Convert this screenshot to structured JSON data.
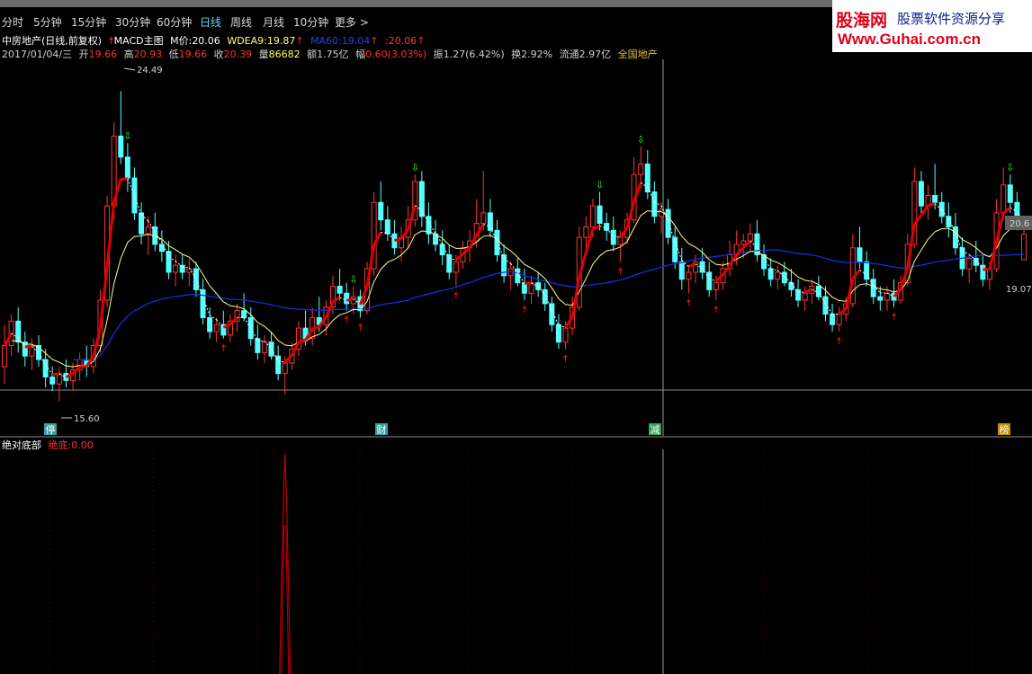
{
  "timeframes": [
    "分时",
    "5分钟",
    "15分钟",
    "30分钟",
    "60分钟",
    "日线",
    "周线",
    "月线",
    "10分钟",
    "更多 >"
  ],
  "active_timeframe": "日线",
  "brand": {
    "name": "股海网",
    "slogan": "股票软件资源分享",
    "url": "Www.Guhai.com.cn"
  },
  "header": {
    "stock": "中房地产(日线,前复权)",
    "indicator": "MACD主图",
    "m_price_label": "M价:",
    "m_price": "20.06",
    "wdea9_label": "WDEA9:",
    "wdea9": "19.87",
    "ma60_label": "MA60:",
    "ma60": "19.04",
    "last_label": ":",
    "last": "20.06"
  },
  "info": {
    "date": "2017/01/04/三",
    "open_label": "开",
    "open": "19.66",
    "high_label": "高",
    "high": "20.93",
    "low_label": "低",
    "low": "19.66",
    "close_label": "收",
    "close": "20.39",
    "vol_label": "量",
    "vol": "86682",
    "amount_label": "额",
    "amount": "1.75亿",
    "change_label": "幅",
    "change": "0.60(3.03%)",
    "amp_label": "振",
    "amp": "1.27(6.42%)",
    "turnover_label": "换",
    "turnover": "2.92%",
    "float_label": "流通",
    "float": "2.97亿",
    "region": "全国地产"
  },
  "sub_panel": {
    "title": "绝对底部",
    "value_label": "绝底:",
    "value": "0.00"
  },
  "price_labels": {
    "high_marker": "24.49",
    "low_marker": "15.60",
    "right_upper": "20.6",
    "right_lower": "19.07"
  },
  "event_markers": [
    "停",
    "财",
    "减",
    "榜"
  ],
  "colors": {
    "up": "#ff3232",
    "down": "#54ffff",
    "ma_fast": "#e00000",
    "ma_slow": "#ffff80",
    "ma60": "#1030e0",
    "buy_arrow": "#ff0000",
    "sell_arrow": "#30ff30"
  },
  "chart_data": {
    "type": "candlestick",
    "ylim": [
      15.0,
      25.4
    ],
    "candles": [
      {
        "o": 16.6,
        "h": 17.8,
        "l": 16.1,
        "c": 17.2
      },
      {
        "o": 17.2,
        "h": 18.1,
        "l": 16.9,
        "c": 17.9
      },
      {
        "o": 17.9,
        "h": 18.3,
        "l": 17.0,
        "c": 17.3
      },
      {
        "o": 17.3,
        "h": 17.6,
        "l": 16.6,
        "c": 16.9
      },
      {
        "o": 16.9,
        "h": 17.4,
        "l": 16.5,
        "c": 17.2
      },
      {
        "o": 17.2,
        "h": 17.5,
        "l": 16.6,
        "c": 16.8
      },
      {
        "o": 16.8,
        "h": 17.1,
        "l": 16.0,
        "c": 16.3
      },
      {
        "o": 16.3,
        "h": 16.6,
        "l": 15.9,
        "c": 16.1
      },
      {
        "o": 16.1,
        "h": 16.6,
        "l": 15.6,
        "c": 16.4
      },
      {
        "o": 16.4,
        "h": 16.8,
        "l": 16.0,
        "c": 16.2
      },
      {
        "o": 16.2,
        "h": 16.7,
        "l": 15.9,
        "c": 16.5
      },
      {
        "o": 16.5,
        "h": 17.0,
        "l": 16.2,
        "c": 16.8
      },
      {
        "o": 16.8,
        "h": 17.2,
        "l": 16.3,
        "c": 16.6
      },
      {
        "o": 16.6,
        "h": 17.4,
        "l": 16.4,
        "c": 17.2
      },
      {
        "o": 17.2,
        "h": 18.8,
        "l": 17.0,
        "c": 18.5
      },
      {
        "o": 18.5,
        "h": 21.5,
        "l": 18.3,
        "c": 21.2
      },
      {
        "o": 21.2,
        "h": 23.6,
        "l": 20.8,
        "c": 23.2
      },
      {
        "o": 23.2,
        "h": 24.49,
        "l": 22.4,
        "c": 22.6
      },
      {
        "o": 22.6,
        "h": 23.0,
        "l": 21.6,
        "c": 22.0
      },
      {
        "o": 22.0,
        "h": 22.3,
        "l": 20.8,
        "c": 21.0
      },
      {
        "o": 21.0,
        "h": 21.3,
        "l": 20.1,
        "c": 20.4
      },
      {
        "o": 20.4,
        "h": 20.9,
        "l": 19.8,
        "c": 20.6
      },
      {
        "o": 20.6,
        "h": 21.0,
        "l": 19.9,
        "c": 20.1
      },
      {
        "o": 20.1,
        "h": 20.5,
        "l": 19.6,
        "c": 19.9
      },
      {
        "o": 19.9,
        "h": 20.2,
        "l": 19.1,
        "c": 19.3
      },
      {
        "o": 19.3,
        "h": 19.8,
        "l": 18.9,
        "c": 19.5
      },
      {
        "o": 19.5,
        "h": 19.8,
        "l": 19.1,
        "c": 19.3
      },
      {
        "o": 19.3,
        "h": 19.7,
        "l": 18.9,
        "c": 19.4
      },
      {
        "o": 19.4,
        "h": 19.6,
        "l": 18.6,
        "c": 18.8
      },
      {
        "o": 18.8,
        "h": 19.1,
        "l": 17.8,
        "c": 18.0
      },
      {
        "o": 18.0,
        "h": 18.3,
        "l": 17.4,
        "c": 17.6
      },
      {
        "o": 17.6,
        "h": 18.0,
        "l": 17.3,
        "c": 17.8
      },
      {
        "o": 17.8,
        "h": 18.2,
        "l": 17.4,
        "c": 17.5
      },
      {
        "o": 17.5,
        "h": 18.1,
        "l": 17.3,
        "c": 17.9
      },
      {
        "o": 17.9,
        "h": 18.4,
        "l": 17.6,
        "c": 18.2
      },
      {
        "o": 18.2,
        "h": 18.7,
        "l": 17.9,
        "c": 18.0
      },
      {
        "o": 18.0,
        "h": 18.3,
        "l": 17.2,
        "c": 17.4
      },
      {
        "o": 17.4,
        "h": 17.8,
        "l": 16.8,
        "c": 17.0
      },
      {
        "o": 17.0,
        "h": 17.5,
        "l": 16.7,
        "c": 17.3
      },
      {
        "o": 17.3,
        "h": 17.6,
        "l": 16.8,
        "c": 16.9
      },
      {
        "o": 16.9,
        "h": 17.2,
        "l": 16.2,
        "c": 16.4
      },
      {
        "o": 16.4,
        "h": 16.9,
        "l": 15.8,
        "c": 16.7
      },
      {
        "o": 16.7,
        "h": 17.3,
        "l": 16.5,
        "c": 17.1
      },
      {
        "o": 17.1,
        "h": 17.9,
        "l": 16.9,
        "c": 17.7
      },
      {
        "o": 17.7,
        "h": 18.2,
        "l": 17.2,
        "c": 17.4
      },
      {
        "o": 17.4,
        "h": 18.3,
        "l": 17.2,
        "c": 18.0
      },
      {
        "o": 18.0,
        "h": 18.6,
        "l": 17.6,
        "c": 17.8
      },
      {
        "o": 17.8,
        "h": 18.5,
        "l": 17.5,
        "c": 18.3
      },
      {
        "o": 18.3,
        "h": 19.2,
        "l": 18.1,
        "c": 18.9
      },
      {
        "o": 18.9,
        "h": 19.4,
        "l": 18.5,
        "c": 18.7
      },
      {
        "o": 18.7,
        "h": 19.0,
        "l": 18.2,
        "c": 18.4
      },
      {
        "o": 18.4,
        "h": 18.9,
        "l": 18.1,
        "c": 18.6
      },
      {
        "o": 18.6,
        "h": 18.8,
        "l": 18.0,
        "c": 18.2
      },
      {
        "o": 18.2,
        "h": 19.6,
        "l": 18.1,
        "c": 19.4
      },
      {
        "o": 19.4,
        "h": 21.6,
        "l": 19.2,
        "c": 21.3
      },
      {
        "o": 21.3,
        "h": 21.9,
        "l": 20.5,
        "c": 20.8
      },
      {
        "o": 20.8,
        "h": 21.2,
        "l": 20.2,
        "c": 20.4
      },
      {
        "o": 20.4,
        "h": 20.8,
        "l": 19.8,
        "c": 20.0
      },
      {
        "o": 20.0,
        "h": 20.6,
        "l": 19.6,
        "c": 20.3
      },
      {
        "o": 20.3,
        "h": 21.2,
        "l": 20.0,
        "c": 20.8
      },
      {
        "o": 20.8,
        "h": 22.1,
        "l": 20.6,
        "c": 21.9
      },
      {
        "o": 21.9,
        "h": 22.2,
        "l": 20.6,
        "c": 20.9
      },
      {
        "o": 20.9,
        "h": 21.3,
        "l": 20.1,
        "c": 20.4
      },
      {
        "o": 20.4,
        "h": 20.8,
        "l": 19.9,
        "c": 20.1
      },
      {
        "o": 20.1,
        "h": 20.5,
        "l": 19.5,
        "c": 19.8
      },
      {
        "o": 19.8,
        "h": 20.1,
        "l": 19.1,
        "c": 19.3
      },
      {
        "o": 19.3,
        "h": 19.8,
        "l": 18.9,
        "c": 19.6
      },
      {
        "o": 19.6,
        "h": 20.2,
        "l": 19.4,
        "c": 20.0
      },
      {
        "o": 20.0,
        "h": 20.5,
        "l": 19.6,
        "c": 20.2
      },
      {
        "o": 20.2,
        "h": 21.4,
        "l": 20.0,
        "c": 20.7
      },
      {
        "o": 20.7,
        "h": 22.2,
        "l": 20.5,
        "c": 21.0
      },
      {
        "o": 21.0,
        "h": 21.4,
        "l": 20.3,
        "c": 20.5
      },
      {
        "o": 20.5,
        "h": 20.8,
        "l": 19.6,
        "c": 19.8
      },
      {
        "o": 19.8,
        "h": 20.1,
        "l": 19.0,
        "c": 19.2
      },
      {
        "o": 19.2,
        "h": 19.6,
        "l": 18.8,
        "c": 19.4
      },
      {
        "o": 19.4,
        "h": 19.7,
        "l": 18.9,
        "c": 19.0
      },
      {
        "o": 19.0,
        "h": 19.4,
        "l": 18.5,
        "c": 18.7
      },
      {
        "o": 18.7,
        "h": 19.2,
        "l": 18.4,
        "c": 19.0
      },
      {
        "o": 19.0,
        "h": 19.3,
        "l": 18.6,
        "c": 18.8
      },
      {
        "o": 18.8,
        "h": 19.0,
        "l": 18.2,
        "c": 18.4
      },
      {
        "o": 18.4,
        "h": 18.6,
        "l": 17.6,
        "c": 17.8
      },
      {
        "o": 17.8,
        "h": 18.1,
        "l": 17.1,
        "c": 17.3
      },
      {
        "o": 17.3,
        "h": 17.9,
        "l": 17.1,
        "c": 17.7
      },
      {
        "o": 17.7,
        "h": 18.6,
        "l": 17.5,
        "c": 18.3
      },
      {
        "o": 18.3,
        "h": 20.6,
        "l": 18.2,
        "c": 20.3
      },
      {
        "o": 20.3,
        "h": 20.9,
        "l": 19.9,
        "c": 20.6
      },
      {
        "o": 20.6,
        "h": 21.4,
        "l": 20.3,
        "c": 21.2
      },
      {
        "o": 21.2,
        "h": 21.6,
        "l": 20.5,
        "c": 20.7
      },
      {
        "o": 20.7,
        "h": 21.0,
        "l": 20.2,
        "c": 20.5
      },
      {
        "o": 20.5,
        "h": 20.9,
        "l": 19.9,
        "c": 20.1
      },
      {
        "o": 20.1,
        "h": 20.5,
        "l": 19.6,
        "c": 20.3
      },
      {
        "o": 20.3,
        "h": 21.0,
        "l": 20.1,
        "c": 20.8
      },
      {
        "o": 20.8,
        "h": 22.6,
        "l": 20.7,
        "c": 22.1
      },
      {
        "o": 22.1,
        "h": 22.9,
        "l": 21.7,
        "c": 22.4
      },
      {
        "o": 22.4,
        "h": 22.8,
        "l": 21.4,
        "c": 21.6
      },
      {
        "o": 21.6,
        "h": 21.9,
        "l": 20.7,
        "c": 20.9
      },
      {
        "o": 20.9,
        "h": 21.3,
        "l": 20.4,
        "c": 21.1
      },
      {
        "o": 21.1,
        "h": 21.4,
        "l": 20.1,
        "c": 20.3
      },
      {
        "o": 20.3,
        "h": 20.6,
        "l": 19.4,
        "c": 19.6
      },
      {
        "o": 19.6,
        "h": 20.0,
        "l": 18.8,
        "c": 19.1
      },
      {
        "o": 19.1,
        "h": 19.5,
        "l": 18.7,
        "c": 19.3
      },
      {
        "o": 19.3,
        "h": 19.8,
        "l": 19.0,
        "c": 19.6
      },
      {
        "o": 19.6,
        "h": 20.0,
        "l": 19.1,
        "c": 19.3
      },
      {
        "o": 19.3,
        "h": 19.6,
        "l": 18.6,
        "c": 18.8
      },
      {
        "o": 18.8,
        "h": 19.2,
        "l": 18.5,
        "c": 19.0
      },
      {
        "o": 19.0,
        "h": 19.6,
        "l": 18.8,
        "c": 19.4
      },
      {
        "o": 19.4,
        "h": 20.2,
        "l": 19.2,
        "c": 19.8
      },
      {
        "o": 19.8,
        "h": 20.5,
        "l": 19.5,
        "c": 20.1
      },
      {
        "o": 20.1,
        "h": 20.4,
        "l": 19.7,
        "c": 20.2
      },
      {
        "o": 20.2,
        "h": 20.7,
        "l": 19.9,
        "c": 20.4
      },
      {
        "o": 20.4,
        "h": 20.8,
        "l": 19.6,
        "c": 19.8
      },
      {
        "o": 19.8,
        "h": 20.1,
        "l": 19.2,
        "c": 19.4
      },
      {
        "o": 19.4,
        "h": 19.7,
        "l": 18.9,
        "c": 19.1
      },
      {
        "o": 19.1,
        "h": 19.5,
        "l": 18.8,
        "c": 19.3
      },
      {
        "o": 19.3,
        "h": 19.6,
        "l": 18.9,
        "c": 19.0
      },
      {
        "o": 19.0,
        "h": 19.4,
        "l": 18.6,
        "c": 18.8
      },
      {
        "o": 18.8,
        "h": 19.1,
        "l": 18.3,
        "c": 18.5
      },
      {
        "o": 18.5,
        "h": 18.9,
        "l": 18.2,
        "c": 18.7
      },
      {
        "o": 18.7,
        "h": 19.1,
        "l": 18.4,
        "c": 18.9
      },
      {
        "o": 18.9,
        "h": 19.2,
        "l": 18.5,
        "c": 18.6
      },
      {
        "o": 18.6,
        "h": 18.9,
        "l": 17.9,
        "c": 18.1
      },
      {
        "o": 18.1,
        "h": 18.4,
        "l": 17.6,
        "c": 17.8
      },
      {
        "o": 17.8,
        "h": 18.3,
        "l": 17.6,
        "c": 18.1
      },
      {
        "o": 18.1,
        "h": 18.6,
        "l": 17.9,
        "c": 18.4
      },
      {
        "o": 18.4,
        "h": 20.4,
        "l": 18.3,
        "c": 20.0
      },
      {
        "o": 20.0,
        "h": 20.6,
        "l": 19.4,
        "c": 19.6
      },
      {
        "o": 19.6,
        "h": 19.9,
        "l": 18.9,
        "c": 19.1
      },
      {
        "o": 19.1,
        "h": 19.4,
        "l": 18.4,
        "c": 18.6
      },
      {
        "o": 18.6,
        "h": 18.9,
        "l": 18.2,
        "c": 18.5
      },
      {
        "o": 18.5,
        "h": 18.9,
        "l": 18.2,
        "c": 18.7
      },
      {
        "o": 18.7,
        "h": 19.1,
        "l": 18.3,
        "c": 18.5
      },
      {
        "o": 18.5,
        "h": 19.2,
        "l": 18.4,
        "c": 19.0
      },
      {
        "o": 19.0,
        "h": 20.4,
        "l": 18.9,
        "c": 20.1
      },
      {
        "o": 20.1,
        "h": 22.3,
        "l": 20.0,
        "c": 21.9
      },
      {
        "o": 21.9,
        "h": 22.2,
        "l": 21.0,
        "c": 21.2
      },
      {
        "o": 21.2,
        "h": 21.8,
        "l": 20.8,
        "c": 21.5
      },
      {
        "o": 21.5,
        "h": 22.4,
        "l": 21.1,
        "c": 21.3
      },
      {
        "o": 21.3,
        "h": 21.6,
        "l": 20.7,
        "c": 20.9
      },
      {
        "o": 20.9,
        "h": 21.3,
        "l": 20.3,
        "c": 20.6
      },
      {
        "o": 20.6,
        "h": 21.0,
        "l": 19.8,
        "c": 20.0
      },
      {
        "o": 20.0,
        "h": 20.3,
        "l": 19.2,
        "c": 19.4
      },
      {
        "o": 19.4,
        "h": 19.8,
        "l": 19.0,
        "c": 19.7
      },
      {
        "o": 19.7,
        "h": 20.2,
        "l": 19.3,
        "c": 19.5
      },
      {
        "o": 19.5,
        "h": 19.8,
        "l": 18.9,
        "c": 19.1
      },
      {
        "o": 19.1,
        "h": 19.6,
        "l": 18.8,
        "c": 19.4
      },
      {
        "o": 19.4,
        "h": 21.4,
        "l": 19.3,
        "c": 21.0
      },
      {
        "o": 21.0,
        "h": 22.3,
        "l": 20.8,
        "c": 21.8
      },
      {
        "o": 21.8,
        "h": 22.1,
        "l": 21.0,
        "c": 21.3
      },
      {
        "o": 21.3,
        "h": 21.6,
        "l": 20.5,
        "c": 20.93
      },
      {
        "o": 19.66,
        "h": 20.93,
        "l": 19.66,
        "c": 20.39
      }
    ],
    "overlay_lines": [
      {
        "name": "M价",
        "color": "#e00000"
      },
      {
        "name": "WDEA9",
        "color": "#ffff80"
      },
      {
        "name": "MA60",
        "color": "#1030e0"
      }
    ],
    "sub_indicator": {
      "name": "绝底",
      "peak_index": 41,
      "peak_value": 1.0
    }
  }
}
